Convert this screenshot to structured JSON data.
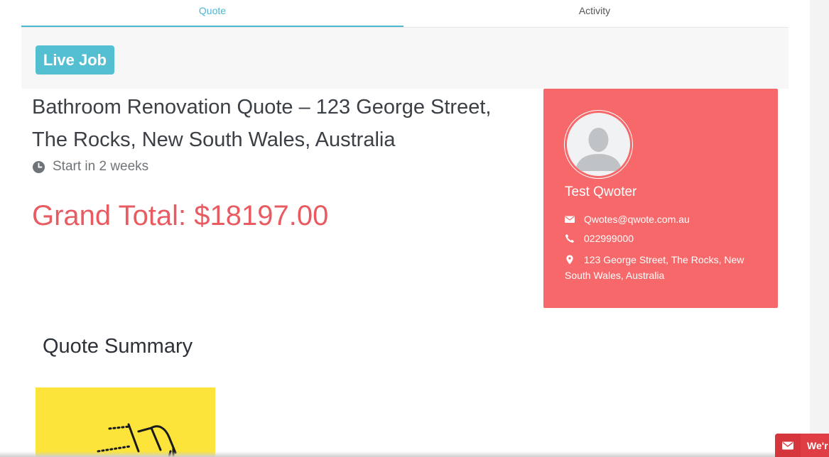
{
  "tabs": [
    {
      "label": "Quote",
      "active": true
    },
    {
      "label": "Activity",
      "active": false
    }
  ],
  "job": {
    "status_badge": "Live Job",
    "title": "Bathroom Renovation Quote – 123 George Street, The Rocks, New South Wales, Australia",
    "start_text": "Start in 2 weeks",
    "grand_total": "Grand Total: $18197.00"
  },
  "contact": {
    "name": "Test Qwoter",
    "email": "Qwotes@qwote.com.au",
    "phone": "022999000",
    "address": "123 George Street, The Rocks, New South Wales, Australia"
  },
  "summary": {
    "title": "Quote Summary"
  },
  "chat": {
    "label": "We'r"
  },
  "icons": {
    "clock": "clock-icon",
    "email": "envelope-icon",
    "phone": "phone-icon",
    "location": "map-pin-icon",
    "avatar": "user-silhouette-icon"
  },
  "colors": {
    "accent": "#4ab8d2",
    "badge": "#55bfd2",
    "total": "#e85b61",
    "card": "#f66869",
    "chat": "#df3f44",
    "thumb": "#fce43a"
  }
}
